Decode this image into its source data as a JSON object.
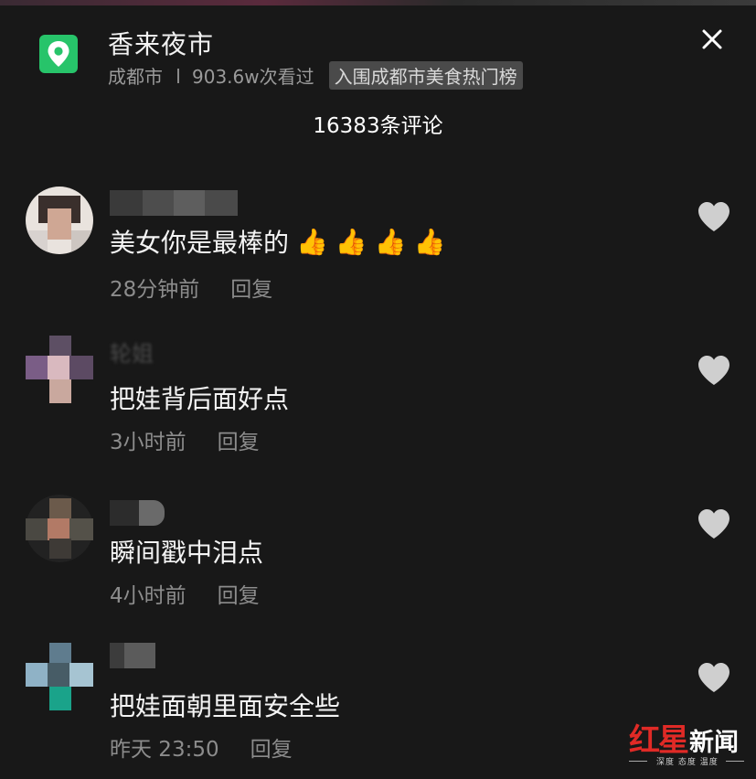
{
  "header": {
    "place_name": "香来夜市",
    "city": "成都市",
    "views": "903.6w次看过",
    "badge": "入围成都市美食热门榜",
    "comment_count": "16383条评论"
  },
  "comments": [
    {
      "text": "美女你是最棒的",
      "emoji_count": 4,
      "emoji": "👍",
      "time": "28分钟前",
      "reply": "回复",
      "username_fragment": ""
    },
    {
      "text": "把娃背后面好点",
      "time": "3小时前",
      "reply": "回复",
      "username_fragment": "轮姐"
    },
    {
      "text": "瞬间戳中泪点",
      "time": "4小时前",
      "reply": "回复",
      "username_fragment": ""
    },
    {
      "text": "把娃面朝里面安全些",
      "time": "昨天 23:50",
      "reply": "回复",
      "username_fragment": ""
    }
  ],
  "icons": {
    "location": "location-pin-icon",
    "close": "close-icon",
    "like": "heart-icon"
  },
  "colors": {
    "background": "#181818",
    "location_icon_bg": "#27c46a",
    "heart": "#cfcfcf",
    "watermark_red": "#e02a26"
  },
  "watermark": {
    "brand_red": "红星",
    "brand_white": "新闻",
    "tagline": "深度 态度 温度"
  }
}
